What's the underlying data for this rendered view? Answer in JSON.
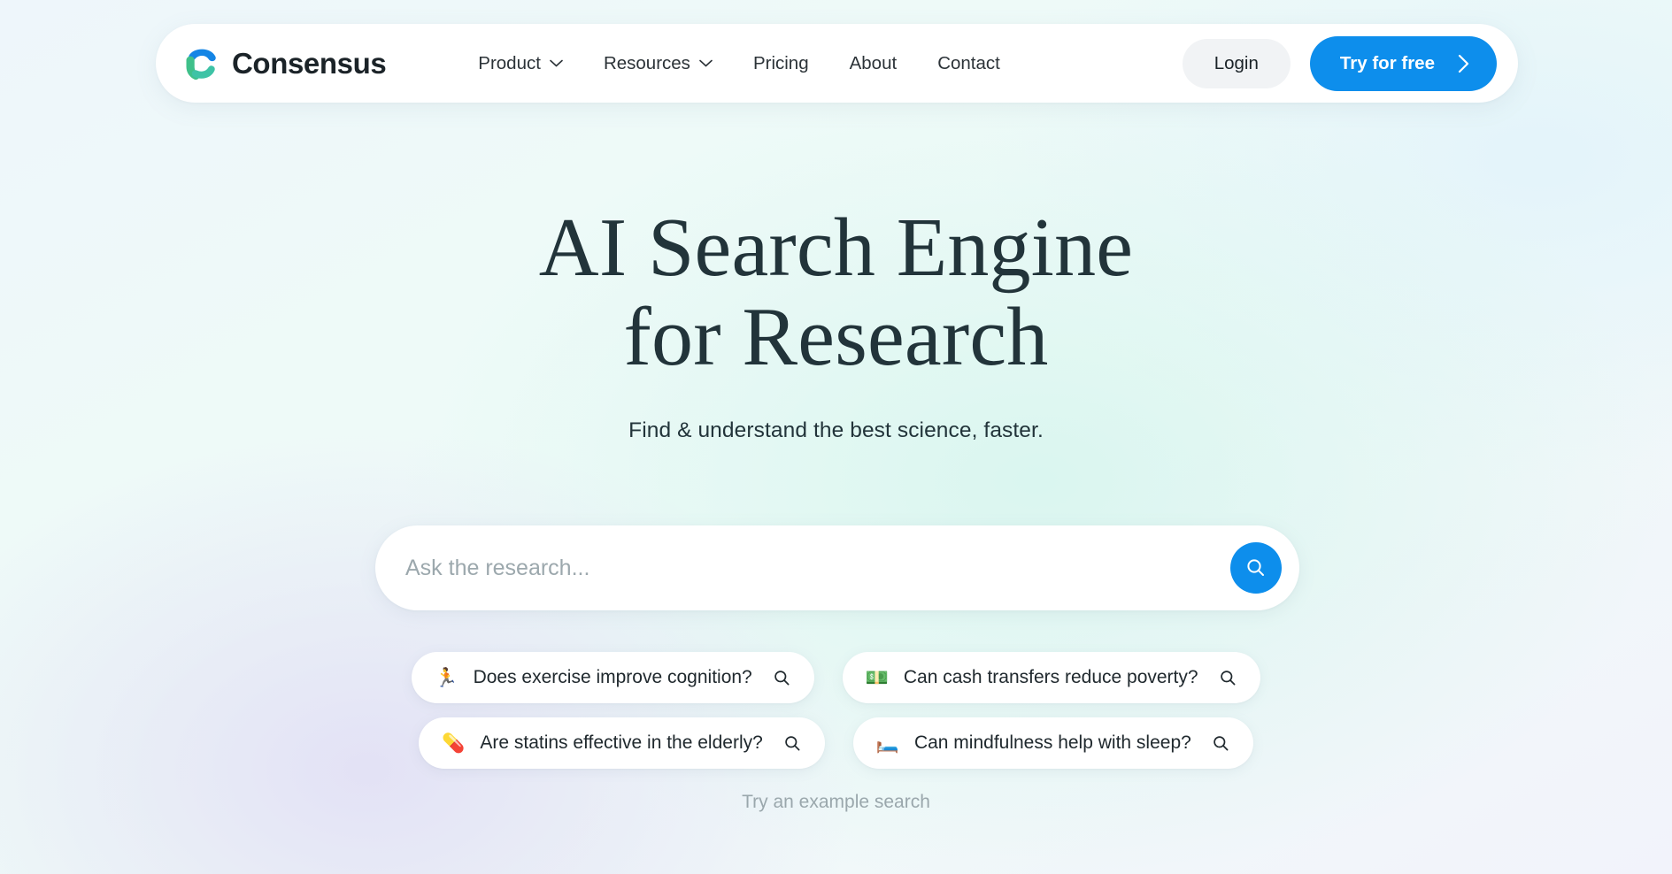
{
  "brand": {
    "name": "Consensus",
    "logo_icon": "consensus-c-logo",
    "logo_colors": {
      "blue": "#1485e5",
      "green": "#3fc08a",
      "teal": "#3ec3a6"
    }
  },
  "nav": {
    "links": [
      {
        "label": "Product",
        "has_dropdown": true,
        "icon": "chevron-down-icon"
      },
      {
        "label": "Resources",
        "has_dropdown": true,
        "icon": "chevron-down-icon"
      },
      {
        "label": "Pricing",
        "has_dropdown": false
      },
      {
        "label": "About",
        "has_dropdown": false
      },
      {
        "label": "Contact",
        "has_dropdown": false
      }
    ],
    "login_label": "Login",
    "cta_label": "Try for free",
    "cta_icon": "chevron-right-icon",
    "cta_color": "#0d8eec"
  },
  "hero": {
    "title_line1": "AI Search Engine",
    "title_line2": "for Research",
    "subtitle": "Find & understand the best science, faster."
  },
  "search": {
    "placeholder": "Ask the research...",
    "value": "",
    "submit_icon": "search-icon",
    "submit_color": "#0d8eec"
  },
  "suggestions": {
    "rows": [
      [
        {
          "emoji": "🏃",
          "emoji_name": "runner-emoji",
          "label": "Does exercise improve cognition?",
          "icon": "search-icon"
        },
        {
          "emoji": "💵",
          "emoji_name": "banknote-emoji",
          "label": "Can cash transfers reduce poverty?",
          "icon": "search-icon"
        }
      ],
      [
        {
          "emoji": "💊",
          "emoji_name": "pill-emoji",
          "label": "Are statins effective in the elderly?",
          "icon": "search-icon"
        },
        {
          "emoji": "🛏️",
          "emoji_name": "bed-emoji",
          "label": "Can mindfulness help with sleep?",
          "icon": "search-icon"
        }
      ]
    ],
    "footer_hint": "Try an example search"
  }
}
